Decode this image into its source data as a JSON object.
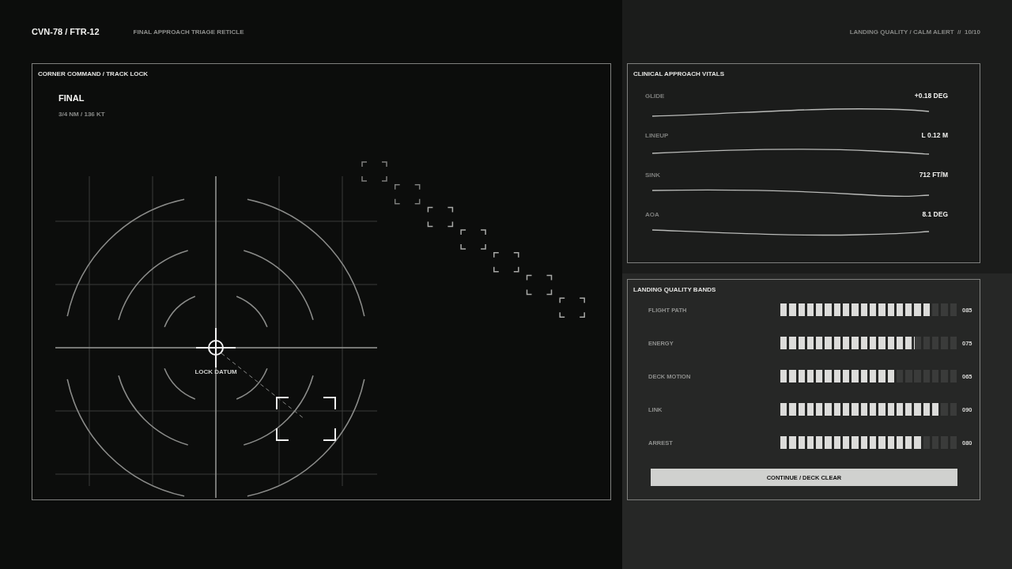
{
  "header": {
    "callsign": "CVN-78 / FTR-12",
    "subtitle": "FINAL APPROACH TRIAGE RETICLE",
    "status": "LANDING QUALITY / CALM ALERT  //  10/10"
  },
  "track_panel": {
    "title": "CORNER COMMAND / TRACK LOCK",
    "phase": "FINAL",
    "readout": "3/4 NM / 136 KT",
    "datum_label": "LOCK DATUM"
  },
  "vitals_panel": {
    "title": "CLINICAL APPROACH VITALS",
    "rows": [
      {
        "label": "GLIDE",
        "value": "+0.18 DEG"
      },
      {
        "label": "LINEUP",
        "value": "L 0.12 M"
      },
      {
        "label": "SINK",
        "value": "712 FT/M"
      },
      {
        "label": "AOA",
        "value": "8.1 DEG"
      }
    ]
  },
  "bands_panel": {
    "title": "LANDING QUALITY BANDS",
    "rows": [
      {
        "label": "FLIGHT PATH",
        "level": 0.85,
        "reading": "085"
      },
      {
        "label": "ENERGY",
        "level": 0.75,
        "reading": "075"
      },
      {
        "label": "DECK MOTION",
        "level": 0.65,
        "reading": "065"
      },
      {
        "label": "LINK",
        "level": 0.9,
        "reading": "090"
      },
      {
        "label": "ARREST",
        "level": 0.8,
        "reading": "080"
      }
    ],
    "button": "CONTINUE / DECK CLEAR"
  }
}
